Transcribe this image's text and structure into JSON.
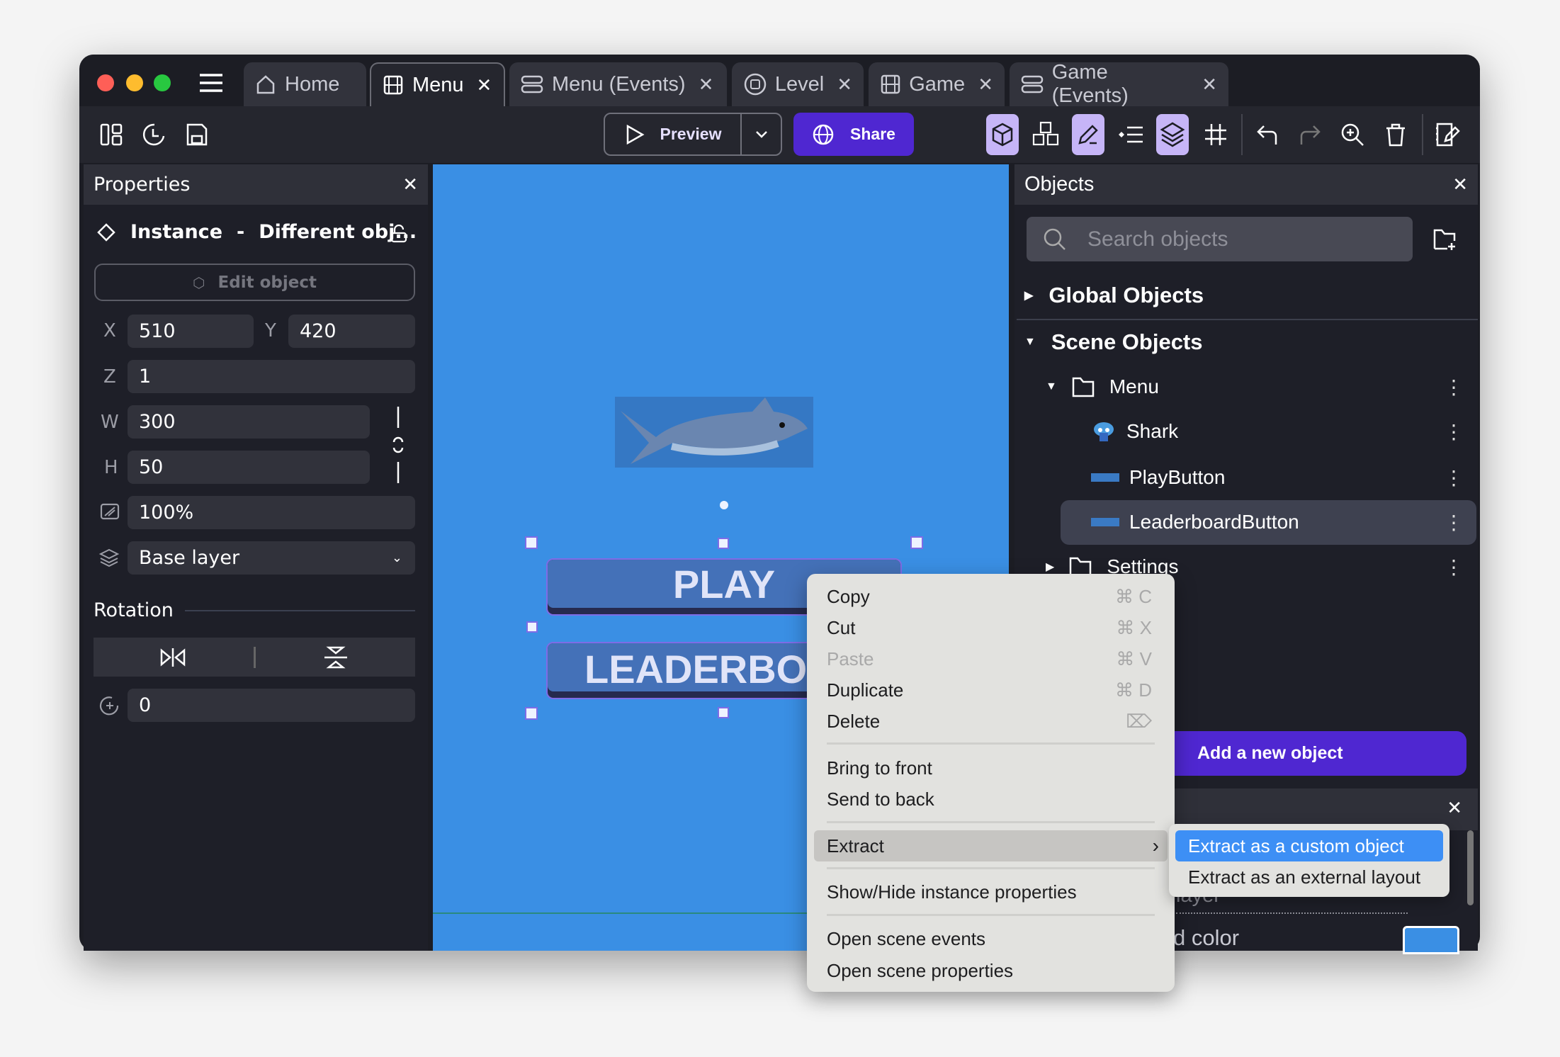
{
  "window": {
    "traffic_lights": [
      "#fe5f57",
      "#febc2e",
      "#28c840"
    ]
  },
  "tabs": [
    {
      "label": "Home",
      "icon": "home-icon",
      "closable": false
    },
    {
      "label": "Menu",
      "icon": "film-icon",
      "closable": true,
      "active": true
    },
    {
      "label": "Menu (Events)",
      "icon": "events-icon",
      "closable": true
    },
    {
      "label": "Level",
      "icon": "level-icon",
      "closable": true
    },
    {
      "label": "Game",
      "icon": "film-icon",
      "closable": true
    },
    {
      "label": "Game (Events)",
      "icon": "events-icon",
      "closable": true
    }
  ],
  "toolbar": {
    "preview_label": "Preview",
    "share_label": "Share",
    "accent": "#4f27d1",
    "toggle_bg": "#c6b5f7"
  },
  "properties": {
    "title": "Properties",
    "instance_label": "Instance",
    "instance_sep": "-",
    "instance_name": "Different obj...",
    "edit_object": "Edit object",
    "x_label": "X",
    "x": "510",
    "y_label": "Y",
    "y": "420",
    "z_label": "Z",
    "z": "1",
    "w_label": "W",
    "w": "300",
    "h_label": "H",
    "h": "50",
    "opacity": "100%",
    "layer": "Base layer",
    "rotation_title": "Rotation",
    "rotation": "0"
  },
  "canvas": {
    "bg": "#3a8fe4",
    "play_text": "PLAY",
    "leaderboard_text": "LEADERBOA"
  },
  "objects": {
    "title": "Objects",
    "search_placeholder": "Search objects",
    "global_objects": "Global Objects",
    "scene_objects": "Scene Objects",
    "items": [
      {
        "label": "Menu",
        "type": "folder"
      },
      {
        "label": "Shark",
        "type": "sprite"
      },
      {
        "label": "PlayButton",
        "type": "button"
      },
      {
        "label": "LeaderboardButton",
        "type": "button",
        "selected": true
      },
      {
        "label": "Settings",
        "type": "folder"
      }
    ],
    "add_button": "Add a new object"
  },
  "layers_panel": {
    "partial_layer_text": "layer",
    "partial_color_text": "d color",
    "color": "#3a8fe4"
  },
  "context_menu": {
    "items": [
      {
        "label": "Copy",
        "shortcut": "⌘ C"
      },
      {
        "label": "Cut",
        "shortcut": "⌘ X"
      },
      {
        "label": "Paste",
        "shortcut": "⌘ V",
        "disabled": true
      },
      {
        "label": "Duplicate",
        "shortcut": "⌘ D"
      },
      {
        "label": "Delete",
        "shortcut": "⌦"
      },
      {
        "label": "Bring to front"
      },
      {
        "label": "Send to back"
      },
      {
        "label": "Extract",
        "submenu": true
      },
      {
        "label": "Show/Hide instance properties"
      },
      {
        "label": "Open scene events"
      },
      {
        "label": "Open scene properties"
      }
    ],
    "submenu": [
      {
        "label": "Extract as a custom object",
        "highlighted": true
      },
      {
        "label": "Extract as an external layout"
      }
    ]
  }
}
